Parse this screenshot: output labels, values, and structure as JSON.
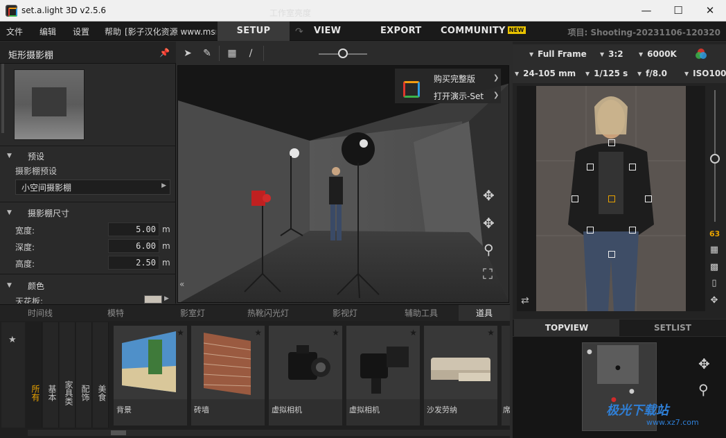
{
  "window": {
    "title": "set.a.light 3D v2.5.6"
  },
  "menu": {
    "items": [
      "文件",
      "编辑",
      "设置",
      "帮助"
    ],
    "extra": "[影子汉化资源 www.msn"
  },
  "modes": {
    "setup": "SETUP",
    "view": "VIEW",
    "export": "EXPORT",
    "community": "COMMUNITY",
    "new_badge": "NEW"
  },
  "project": "项目: Shooting-20231106-120320",
  "left_panel": {
    "title": "矩形摄影棚",
    "preset_section": "预设",
    "preset_label": "摄影棚预设",
    "preset_value": "小空间摄影棚",
    "size_section": "摄影棚尺寸",
    "dimensions": [
      {
        "label": "宽度:",
        "value": "5.00",
        "unit": "m"
      },
      {
        "label": "深度:",
        "value": "6.00",
        "unit": "m"
      },
      {
        "label": "高度:",
        "value": "2.50",
        "unit": "m"
      }
    ],
    "color_section": "颜色",
    "ceiling_label": "天花板:"
  },
  "viewport": {
    "brightness_label": "工作室亮度",
    "brightness_level": 0.5,
    "trial_menu": [
      "购买完整版",
      "打开演示-Set"
    ]
  },
  "camera": {
    "sensor": "Full Frame",
    "ratio": "3:2",
    "wb": "6000K",
    "lens": "24-105 mm",
    "shutter": "1/125 s",
    "aperture": "f/8.0",
    "iso": "ISO100",
    "focal": "63"
  },
  "right_tabs": {
    "topview": "TOPVIEW",
    "setlist": "SETLIST"
  },
  "library": {
    "tabs": [
      "时间线",
      "模特",
      "影室灯",
      "热靴闪光灯",
      "影视灯",
      "辅助工具",
      "道具"
    ],
    "categories": [
      "所有",
      "基本",
      "家具类",
      "配饰",
      "美食"
    ],
    "items": [
      {
        "name": "背景"
      },
      {
        "name": "砖墙"
      },
      {
        "name": "虚拟相机"
      },
      {
        "name": "虚拟相机"
      },
      {
        "name": "沙发劳纳"
      },
      {
        "name": "席"
      }
    ]
  },
  "watermark": {
    "text": "极光下载站",
    "url": "www.xz7.com"
  }
}
